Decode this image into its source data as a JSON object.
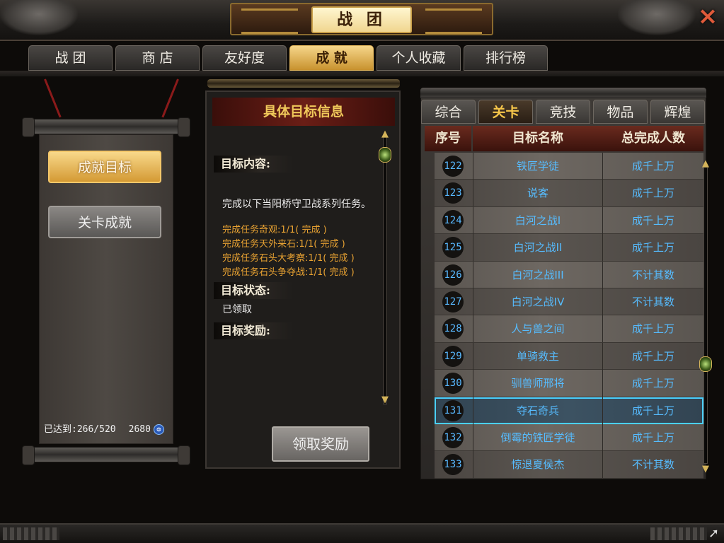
{
  "window": {
    "title": "战 团",
    "close_icon": "×"
  },
  "main_tabs": [
    {
      "label": "战 团",
      "active": false
    },
    {
      "label": "商 店",
      "active": false
    },
    {
      "label": "友好度",
      "active": false
    },
    {
      "label": "成 就",
      "active": true
    },
    {
      "label": "个人收藏",
      "active": false
    },
    {
      "label": "排行榜",
      "active": false
    }
  ],
  "left": {
    "buttons": [
      {
        "label": "成就目标",
        "active": true
      },
      {
        "label": "关卡成就",
        "active": false
      }
    ],
    "reached_label": "已达到:266/520",
    "points": "2680"
  },
  "detail": {
    "header": "具体目标信息",
    "content_label": "目标内容:",
    "description": "完成以下当阳桥守卫战系列任务。",
    "tasks": [
      "完成任务奇观:1/1( 完成 )",
      "完成任务天外来石:1/1( 完成 )",
      "完成任务石头大考察:1/1( 完成 )",
      "完成任务石头争夺战:1/1( 完成 )"
    ],
    "status_label": "目标状态:",
    "status_value": "已领取",
    "reward_label": "目标奖励:",
    "claim_button": "领取奖励"
  },
  "right": {
    "sub_tabs": [
      {
        "label": "综合",
        "active": false
      },
      {
        "label": "关卡",
        "active": true
      },
      {
        "label": "竞技",
        "active": false
      },
      {
        "label": "物品",
        "active": false
      },
      {
        "label": "辉煌",
        "active": false
      }
    ],
    "columns": [
      "序号",
      "目标名称",
      "总完成人数"
    ],
    "rows": [
      {
        "no": "122",
        "name": "铁匠学徒",
        "count": "成千上万"
      },
      {
        "no": "123",
        "name": "说客",
        "count": "成千上万"
      },
      {
        "no": "124",
        "name": "白河之战I",
        "count": "成千上万"
      },
      {
        "no": "125",
        "name": "白河之战II",
        "count": "成千上万"
      },
      {
        "no": "126",
        "name": "白河之战III",
        "count": "不计其数"
      },
      {
        "no": "127",
        "name": "白河之战IV",
        "count": "不计其数"
      },
      {
        "no": "128",
        "name": "人与兽之间",
        "count": "成千上万"
      },
      {
        "no": "129",
        "name": "单骑救主",
        "count": "成千上万"
      },
      {
        "no": "130",
        "name": "驯兽师邢将",
        "count": "成千上万"
      },
      {
        "no": "131",
        "name": "夺石奇兵",
        "count": "成千上万",
        "selected": true
      },
      {
        "no": "132",
        "name": "倒霉的铁匠学徒",
        "count": "成千上万"
      },
      {
        "no": "133",
        "name": "惊退夏侯杰",
        "count": "不计其数"
      }
    ]
  },
  "icons": {
    "scroll_up": "▲",
    "scroll_down": "▼",
    "points": "❂"
  }
}
